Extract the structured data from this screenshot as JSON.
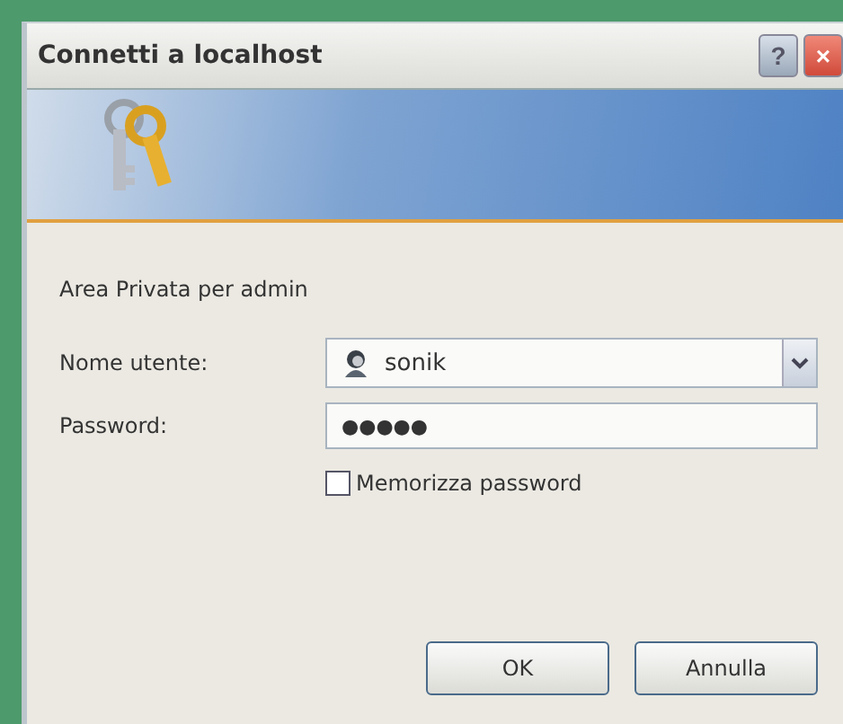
{
  "window": {
    "title": "Connetti a localhost",
    "buttons": [
      "?",
      "×"
    ]
  },
  "message": "Area Privata per admin",
  "fields": [
    {
      "kind": "combo",
      "label": "Nome utente:",
      "value": "sonik"
    },
    {
      "kind": "password",
      "label": "Password:",
      "value": "●●●●●"
    }
  ],
  "remember": {
    "label": "Memorizza password",
    "checked": false
  },
  "buttons": [
    "OK",
    "Annulla"
  ]
}
